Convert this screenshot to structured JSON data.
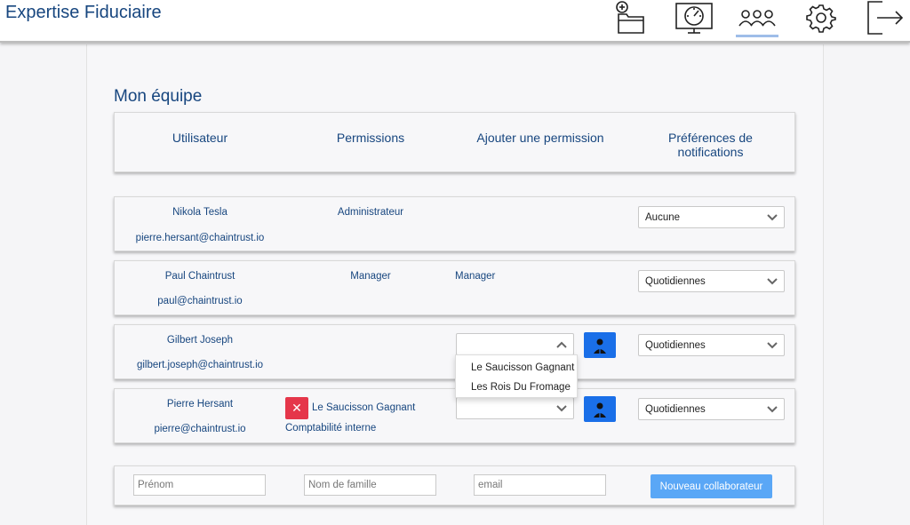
{
  "app": {
    "brand": "Expertise Fiduciaire"
  },
  "nav": {
    "icons": [
      "folder-add-icon",
      "dashboard-monitor-icon",
      "team-users-icon",
      "gear-icon",
      "logout-icon"
    ],
    "active": "team-users-icon",
    "active_color": "#9ebde8"
  },
  "page": {
    "title": "Mon équipe"
  },
  "table": {
    "headers": {
      "user": "Utilisateur",
      "permissions": "Permissions",
      "add_permission": "Ajouter une permission",
      "notifications_line1": "Préférences de",
      "notifications_line2": "notifications"
    },
    "rows": [
      {
        "name": "Nikola Tesla",
        "email": "pierre.hersant@chaintrust.io",
        "permission": "Administrateur",
        "added_permission": "",
        "notification": "Aucune"
      },
      {
        "name": "Paul Chaintrust",
        "email": "paul@chaintrust.io",
        "permission": "Manager",
        "added_permission": "Manager",
        "notification": "Quotidiennes"
      },
      {
        "name": "Gilbert Joseph",
        "email": "gilbert.joseph@chaintrust.io",
        "permission": "",
        "added_permission": "",
        "notification": "Quotidiennes"
      },
      {
        "name": "Pierre Hersant",
        "email": "pierre@chaintrust.io",
        "permission": "Le Saucisson Gagnant",
        "permission_sub": "Comptabilité interne",
        "added_permission": "",
        "notification": "Quotidiennes"
      }
    ]
  },
  "dropdown": {
    "options": [
      "Le Saucisson Gagnant",
      "Les Rois Du Fromage"
    ]
  },
  "new_user_form": {
    "first_name_placeholder": "Prénom",
    "last_name_placeholder": "Nom de famille",
    "email_placeholder": "email",
    "submit_label": "Nouveau collaborateur"
  },
  "colors": {
    "brand": "#17467f",
    "primary_button": "#1a6fe8",
    "submit_button": "#5aa7f6",
    "danger": "#e5364a"
  }
}
